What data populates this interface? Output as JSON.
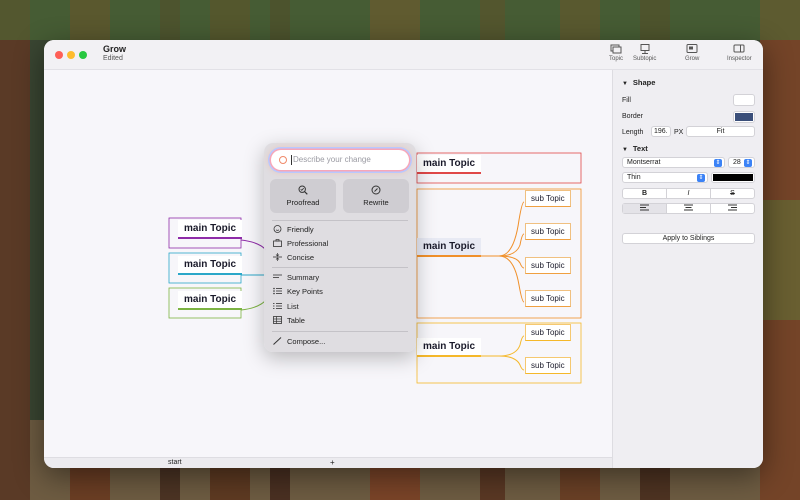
{
  "window": {
    "title": "Grow",
    "subtitle": "Edited"
  },
  "toolbar": {
    "topic_label": "Topic",
    "subtopic_label": "Subtopic",
    "grow_label": "Grow",
    "inspector_label": "Inspector"
  },
  "inspector": {
    "shape_heading": "Shape",
    "fill_label": "Fill",
    "border_label": "Border",
    "border_color": "#3b4f7a",
    "length_label": "Length",
    "length_value": "196.",
    "length_unit": "PX",
    "fit_label": "Fit",
    "text_heading": "Text",
    "font_family": "Montserrat",
    "font_size": "28",
    "font_weight": "Thin",
    "text_color": "#000000",
    "bold_label": "B",
    "italic_label": "I",
    "strike_label": "S",
    "apply_label": "Apply to Siblings"
  },
  "mindmap": {
    "left_topics": [
      "main Topic",
      "main Topic",
      "main Topic"
    ],
    "left_colors": [
      "#8e2ca8",
      "#2aa7c9",
      "#7cb342"
    ],
    "right_topics": [
      "main Topic",
      "main Topic",
      "main Topic"
    ],
    "right_colors": [
      "#e04848",
      "#f0902a",
      "#f5b82a"
    ],
    "subtopics": [
      "sub Topic",
      "sub Topic",
      "sub Topic",
      "sub Topic",
      "sub Topic",
      "sub Topic"
    ]
  },
  "writing_tools": {
    "prompt_placeholder": "Describe your change",
    "proofread_label": "Proofread",
    "rewrite_label": "Rewrite",
    "friendly_label": "Friendly",
    "professional_label": "Professional",
    "concise_label": "Concise",
    "summary_label": "Summary",
    "key_points_label": "Key Points",
    "list_label": "List",
    "table_label": "Table",
    "compose_label": "Compose..."
  },
  "bottombar": {
    "start_label": "start",
    "add_label": "+"
  }
}
